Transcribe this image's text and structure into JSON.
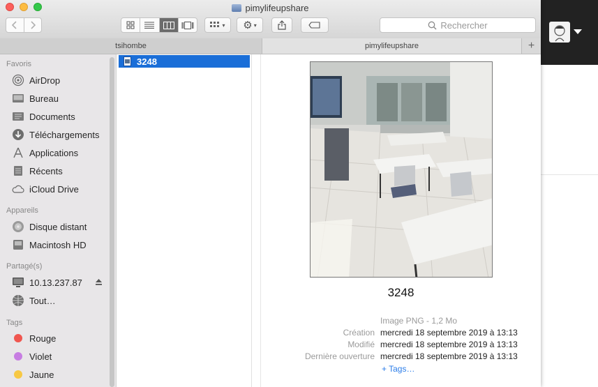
{
  "window": {
    "title": "pimylifeupshare"
  },
  "toolbar": {
    "search_placeholder": "Rechercher"
  },
  "tabs": [
    {
      "label": "tsihombe"
    },
    {
      "label": "pimylifeupshare"
    }
  ],
  "sidebar": {
    "sections": {
      "favoris": "Favoris",
      "appareils": "Appareils",
      "partage": "Partagé(s)",
      "tags": "Tags"
    },
    "favoris": [
      {
        "label": "AirDrop",
        "icon": "airdrop-icon"
      },
      {
        "label": "Bureau",
        "icon": "desktop-icon"
      },
      {
        "label": "Documents",
        "icon": "documents-icon"
      },
      {
        "label": "Téléchargements",
        "icon": "downloads-icon"
      },
      {
        "label": "Applications",
        "icon": "applications-icon"
      },
      {
        "label": "Récents",
        "icon": "recents-icon"
      },
      {
        "label": "iCloud Drive",
        "icon": "cloud-icon"
      }
    ],
    "appareils": [
      {
        "label": "Disque distant",
        "icon": "disc-icon"
      },
      {
        "label": "Macintosh HD",
        "icon": "harddrive-icon"
      }
    ],
    "partage": [
      {
        "label": "10.13.237.87",
        "icon": "monitor-icon"
      },
      {
        "label": "Tout…",
        "icon": "network-icon"
      }
    ],
    "tags": [
      {
        "label": "Rouge",
        "color": "#f0564f"
      },
      {
        "label": "Violet",
        "color": "#c77de2"
      },
      {
        "label": "Jaune",
        "color": "#f7c843"
      }
    ]
  },
  "column": {
    "selected_item": "3248"
  },
  "preview": {
    "file_name": "3248",
    "kind": "Image PNG - 1,2 Mo",
    "created_label": "Création",
    "created_value": "mercredi 18 septembre 2019 à 13:13",
    "modified_label": "Modifié",
    "modified_value": "mercredi 18 septembre 2019 à 13:13",
    "opened_label": "Dernière ouverture",
    "opened_value": "mercredi 18 septembre 2019 à 13:13",
    "tags_link": "+ Tags…"
  }
}
